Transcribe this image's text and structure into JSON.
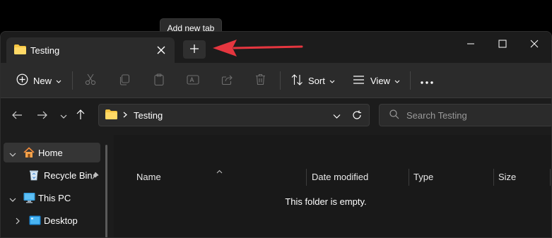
{
  "tooltip": {
    "text": "Add new tab"
  },
  "tab": {
    "title": "Testing"
  },
  "toolbar": {
    "new_label": "New",
    "sort_label": "Sort",
    "view_label": "View"
  },
  "address": {
    "path_segment": "Testing"
  },
  "search": {
    "placeholder": "Search Testing"
  },
  "sidebar": {
    "items": [
      {
        "label": "Home"
      },
      {
        "label": "Recycle Bin"
      },
      {
        "label": "This PC"
      },
      {
        "label": "Desktop"
      }
    ]
  },
  "columns": {
    "name": "Name",
    "date_modified": "Date modified",
    "type": "Type",
    "size": "Size"
  },
  "empty_message": "This folder is empty.",
  "colors": {
    "accent_arrow": "#e5363f",
    "folder": "#f5c542",
    "window_bg": "#1c1c1c",
    "toolbar_bg": "#2b2b2b"
  }
}
